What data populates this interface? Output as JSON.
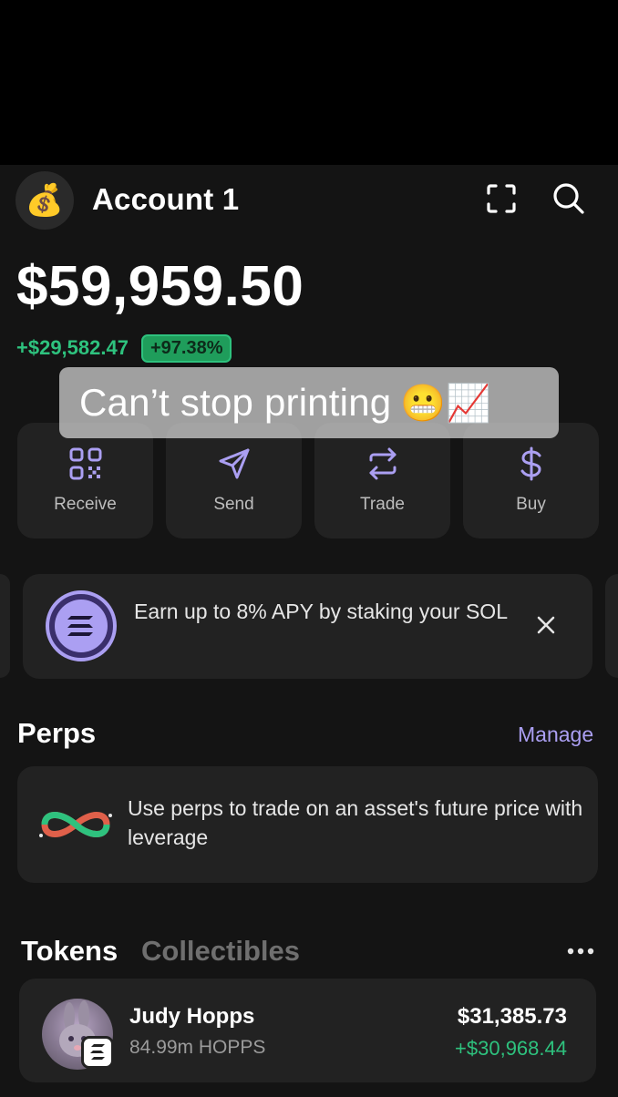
{
  "header": {
    "avatar_emoji": "💰",
    "account_name": "Account 1",
    "icons": [
      "scan-icon",
      "search-icon"
    ]
  },
  "balance": {
    "total": "$59,959.50",
    "change_abs": "+$29,582.47",
    "change_pct": "+97.38%"
  },
  "caption": {
    "text": "Can’t stop printing",
    "emojis": "😬📈"
  },
  "actions": [
    {
      "label": "Receive",
      "icon": "qr-code-icon"
    },
    {
      "label": "Send",
      "icon": "send-icon"
    },
    {
      "label": "Trade",
      "icon": "swap-icon"
    },
    {
      "label": "Buy",
      "icon": "dollar-icon"
    }
  ],
  "promo": {
    "text": "Earn up to 8% APY by staking your SOL",
    "icon": "solana-icon"
  },
  "perps": {
    "title": "Perps",
    "manage_label": "Manage",
    "description": "Use perps to trade on an asset's future price with leverage"
  },
  "tabs": {
    "tokens": "Tokens",
    "collectibles": "Collectibles"
  },
  "tokens": [
    {
      "name": "Judy Hopps",
      "amount": "84.99m HOPPS",
      "value": "$31,385.73",
      "change": "+$30,968.44"
    }
  ],
  "colors": {
    "background": "#141414",
    "card": "#222222",
    "positive": "#2ec27e",
    "accent": "#ab9ff2"
  }
}
